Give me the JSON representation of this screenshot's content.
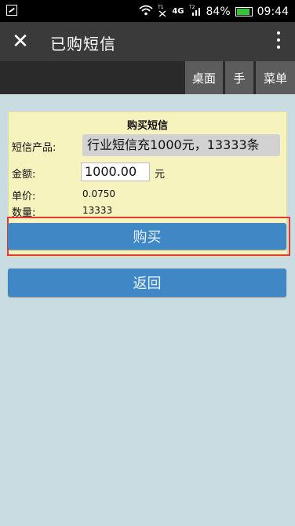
{
  "status_bar": {
    "battery": "84%",
    "time": "09:44",
    "signal_label": "4G",
    "icons": [
      "image-icon",
      "wifi-icon",
      "signal-t1-icon",
      "signal-t2-icon",
      "battery-icon"
    ],
    "battery_color": "#35c635"
  },
  "title_bar": {
    "close_glyph": "✕",
    "title": "已购短信"
  },
  "toolbar": {
    "desktop": "桌面",
    "hand": "手",
    "menu": "菜单"
  },
  "form": {
    "heading": "购买短信",
    "product_label": "短信产品:",
    "product_value": "行业短信充1000元，13333条",
    "amount_label": "金额:",
    "amount_value": "1000.00",
    "amount_unit": "元",
    "price_label": "单价:",
    "price_value": "0.0750",
    "qty_label": "数量:",
    "qty_value": "13333"
  },
  "buttons": {
    "buy": "购买",
    "back": "返回"
  },
  "colors": {
    "accent": "#3f87c5",
    "panel_bg": "#f7f3bf",
    "page_bg": "#c9dce2",
    "highlight": "#e23a2e"
  }
}
